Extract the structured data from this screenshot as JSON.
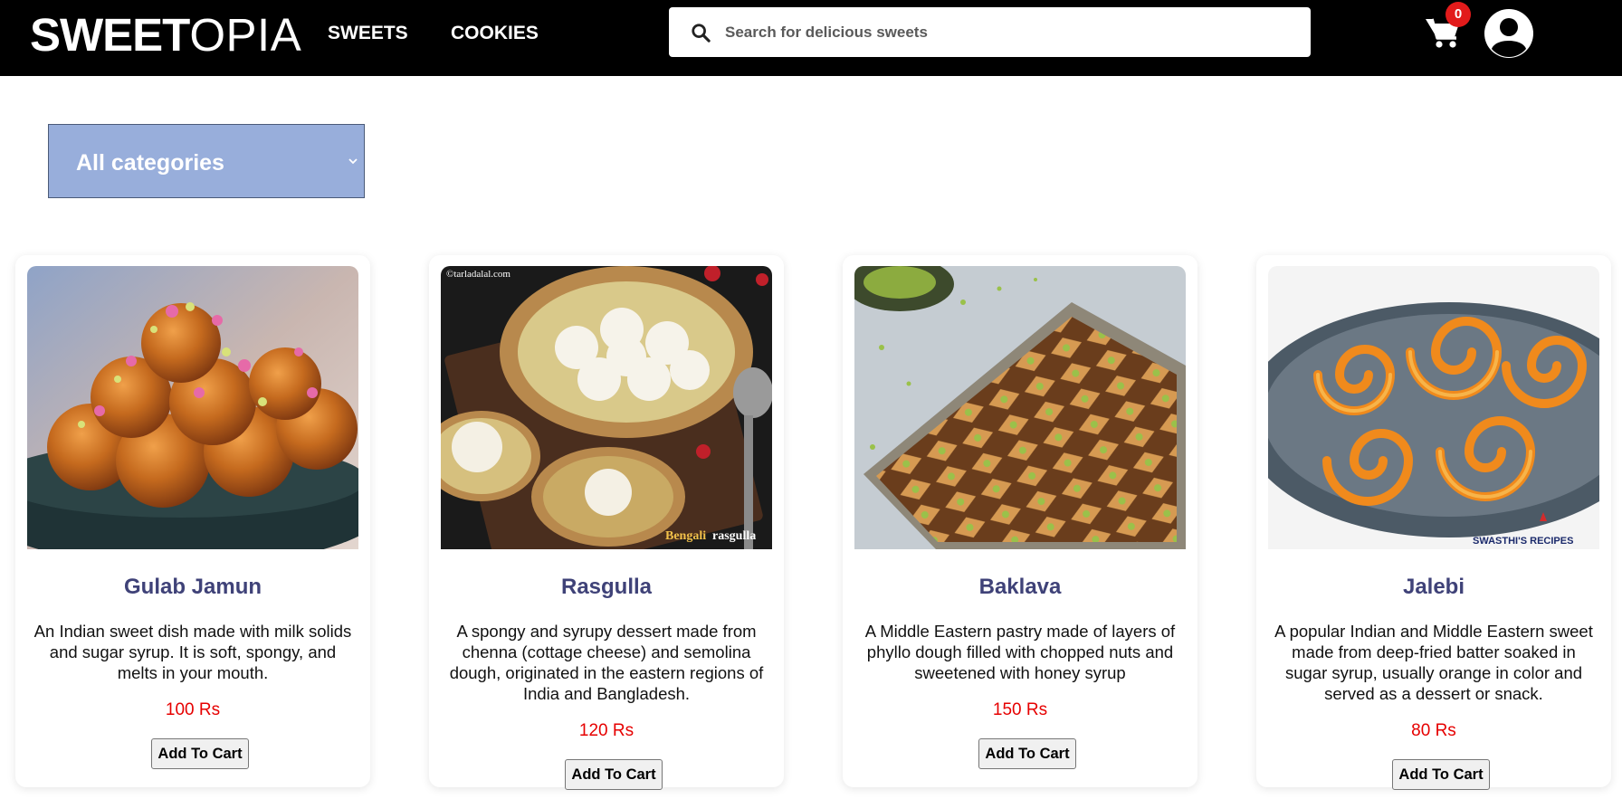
{
  "brand": {
    "part1": "SWEET",
    "part2": "OPIA"
  },
  "nav": {
    "sweets": "SWEETS",
    "cookies": "COOKIES"
  },
  "search": {
    "placeholder": "Search for delicious sweets",
    "value": ""
  },
  "cart": {
    "count": "0"
  },
  "filter": {
    "selected": "All categories"
  },
  "products": [
    {
      "name": "Gulab Jamun",
      "description": "An Indian sweet dish made with milk solids and sugar syrup. It is soft, spongy, and melts in your mouth.",
      "price": "100 Rs",
      "button": "Add To Cart"
    },
    {
      "name": "Rasgulla",
      "description": "A spongy and syrupy dessert made from chenna (cottage cheese) and semolina dough, originated in the eastern regions of India and Bangladesh.",
      "price": "120 Rs",
      "button": "Add To Cart",
      "image_text": {
        "watermark": "©tarladalal.com",
        "caption_a": "Bengali",
        "caption_b": "rasgulla"
      }
    },
    {
      "name": "Baklava",
      "description": "A Middle Eastern pastry made of layers of phyllo dough filled with chopped nuts and sweetened with honey syrup",
      "price": "150 Rs",
      "button": "Add To Cart"
    },
    {
      "name": "Jalebi",
      "description": "A popular Indian and Middle Eastern sweet made from deep-fried batter soaked in sugar syrup, usually orange in color and served as a dessert or snack.",
      "price": "80 Rs",
      "button": "Add To Cart",
      "image_text": {
        "watermark": "SWASTHI'S RECIPES"
      }
    }
  ],
  "colors": {
    "navbar": "#000000",
    "filter_bg": "#98aedb",
    "title": "#3f4278",
    "price": "#e60000",
    "badge": "#e21b1b"
  }
}
